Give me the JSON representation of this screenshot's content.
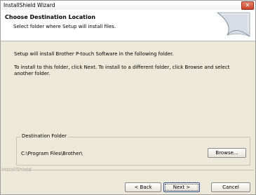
{
  "window": {
    "title": "InstallShield Wizard",
    "close_glyph": "✕"
  },
  "header": {
    "title": "Choose Destination Location",
    "subtitle": "Select folder where Setup will install files."
  },
  "body": {
    "line1": "Setup will install Brother P-touch Software in the following folder.",
    "line2": "To install to this folder, click Next. To install to a different folder, click Browse and select",
    "line3": "another folder."
  },
  "destination": {
    "legend": "Destination Folder",
    "path": "C:\\Program Files\\Brother\\",
    "browse_label": "Browse..."
  },
  "footer": {
    "brand": "InstallShield",
    "back_label": "< Back",
    "next_label": "Next >",
    "cancel_label": "Cancel"
  },
  "icons": {
    "header_graphic": "curled-page-graphic-icon"
  }
}
